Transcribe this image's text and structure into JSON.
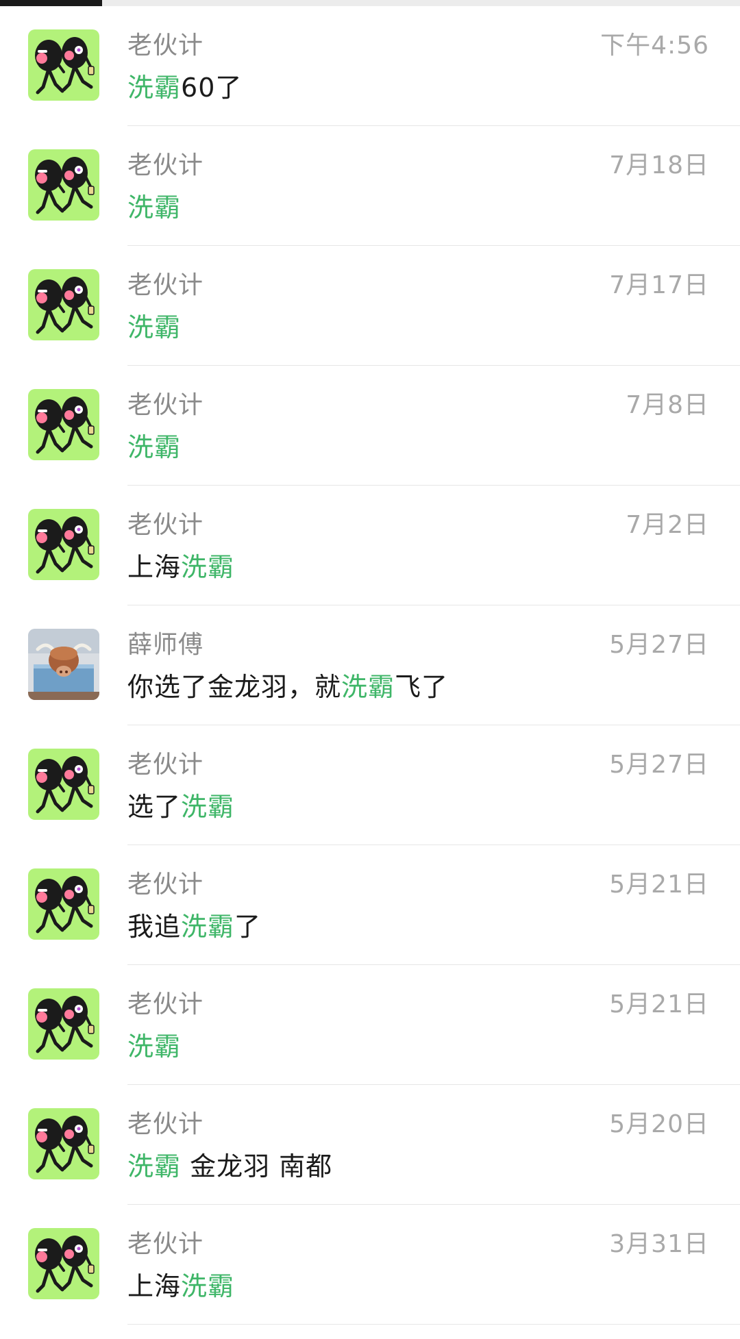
{
  "scroll_progress": 0.138,
  "highlight_color": "#3fb668",
  "chats": [
    {
      "avatar": "cartoon-friends-avatar",
      "name": "老伙计",
      "time": "下午4:56",
      "message": [
        {
          "text": "洗霸",
          "hl": true
        },
        {
          "text": "60了",
          "hl": false
        }
      ]
    },
    {
      "avatar": "cartoon-friends-avatar",
      "name": "老伙计",
      "time": "7月18日",
      "message": [
        {
          "text": "洗霸",
          "hl": true
        }
      ]
    },
    {
      "avatar": "cartoon-friends-avatar",
      "name": "老伙计",
      "time": "7月17日",
      "message": [
        {
          "text": "洗霸",
          "hl": true
        }
      ]
    },
    {
      "avatar": "cartoon-friends-avatar",
      "name": "老伙计",
      "time": "7月8日",
      "message": [
        {
          "text": "洗霸",
          "hl": true
        }
      ]
    },
    {
      "avatar": "cartoon-friends-avatar",
      "name": "老伙计",
      "time": "7月2日",
      "message": [
        {
          "text": "上海",
          "hl": false
        },
        {
          "text": "洗霸",
          "hl": true
        }
      ]
    },
    {
      "avatar": "highland-cow-avatar",
      "name": "薛师傅",
      "time": "5月27日",
      "message": [
        {
          "text": "你选了金龙羽，就",
          "hl": false
        },
        {
          "text": "洗霸",
          "hl": true
        },
        {
          "text": "飞了",
          "hl": false
        }
      ]
    },
    {
      "avatar": "cartoon-friends-avatar",
      "name": "老伙计",
      "time": "5月27日",
      "message": [
        {
          "text": "选了",
          "hl": false
        },
        {
          "text": "洗霸",
          "hl": true
        }
      ]
    },
    {
      "avatar": "cartoon-friends-avatar",
      "name": "老伙计",
      "time": "5月21日",
      "message": [
        {
          "text": "我追",
          "hl": false
        },
        {
          "text": "洗霸",
          "hl": true
        },
        {
          "text": "了",
          "hl": false
        }
      ]
    },
    {
      "avatar": "cartoon-friends-avatar",
      "name": "老伙计",
      "time": "5月21日",
      "message": [
        {
          "text": "洗霸",
          "hl": true
        }
      ]
    },
    {
      "avatar": "cartoon-friends-avatar",
      "name": "老伙计",
      "time": "5月20日",
      "message": [
        {
          "text": "洗霸",
          "hl": true
        },
        {
          "text": " 金龙羽 南都",
          "hl": false
        }
      ]
    },
    {
      "avatar": "cartoon-friends-avatar",
      "name": "老伙计",
      "time": "3月31日",
      "message": [
        {
          "text": "上海",
          "hl": false
        },
        {
          "text": "洗霸",
          "hl": true
        }
      ]
    }
  ]
}
